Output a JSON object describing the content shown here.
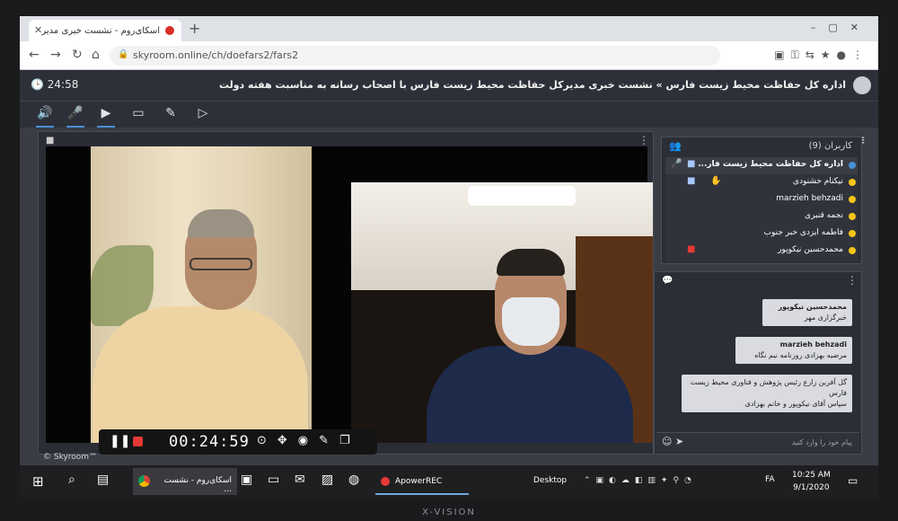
{
  "browser": {
    "tab_title": "اسکای‌روم - نشست خبری مدیر",
    "url": "skyroom.online/ch/doefars2/fars2"
  },
  "skyroom": {
    "timer": "24:58",
    "room_title": "اداره کل حفاظت محیط زیست فارس » نشست خبری مدیرکل حفاظت محیط زیست فارس با اصحاب رسانه به مناسبت هفته دولت",
    "watermark": "© Skyroom™"
  },
  "recorder": {
    "elapsed": "00:24:59"
  },
  "users": {
    "header": "کاربران (9)",
    "items": [
      {
        "name": "اداره کل حفاظت محیط زیست فار..."
      },
      {
        "name": "نیکنام خشنودی"
      },
      {
        "name": "marzieh behzadi"
      },
      {
        "name": "نجمه قنبری"
      },
      {
        "name": "فاطمه ایزدی خبر جنوب"
      },
      {
        "name": "محمدحسین نیکوپور"
      }
    ]
  },
  "chat": {
    "messages": [
      {
        "name": "محمدحسین نیکوپور",
        "text": "خبرگزاری مهر"
      },
      {
        "name": "marzieh behzadi",
        "text": "مرضیه بهزادی   روزنامه نیم نگاه"
      },
      {
        "name": "",
        "text": "گل آفرین زارع رئیس پژوهش و فناوری محیط زیست فارس"
      },
      {
        "name": "",
        "text": "سپاس آقای نیکوپور و خانم بهزادی"
      }
    ],
    "placeholder": "پیام خود را وارد کنید"
  },
  "taskbar": {
    "chrome_label": "اسکای‌روم - نشست ...",
    "apower_label": "ApowerREC",
    "desktop_label": "Desktop",
    "lang": "FA",
    "time": "10:25 AM",
    "date": "9/1/2020"
  },
  "monitor": {
    "brand": "X-VISION"
  },
  "colors": {
    "accent": "#4a90d9",
    "record": "#e53935",
    "panel_bg": "#2b2e36"
  }
}
